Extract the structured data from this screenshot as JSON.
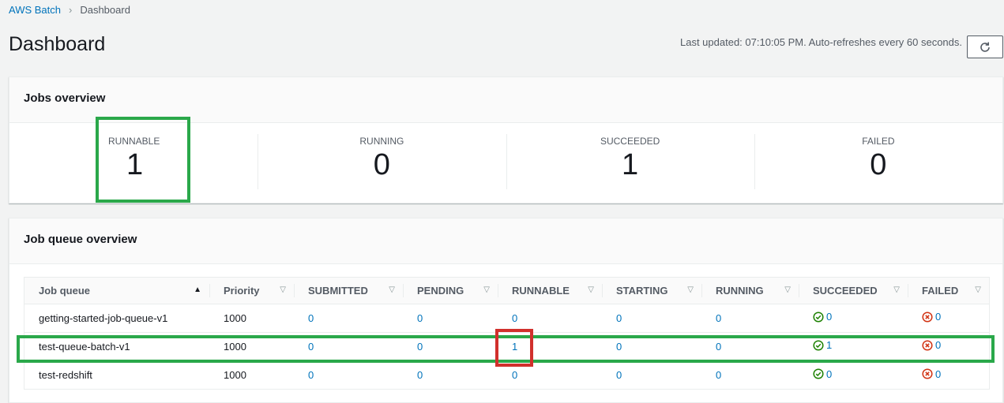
{
  "breadcrumb": {
    "root": "AWS Batch",
    "current": "Dashboard"
  },
  "page": {
    "title": "Dashboard",
    "last_updated": "Last updated: 07:10:05 PM. Auto-refreshes every 60 seconds."
  },
  "jobs_overview": {
    "title": "Jobs overview",
    "stats": [
      {
        "label": "RUNNABLE",
        "value": "1"
      },
      {
        "label": "RUNNING",
        "value": "0"
      },
      {
        "label": "SUCCEEDED",
        "value": "1"
      },
      {
        "label": "FAILED",
        "value": "0"
      }
    ]
  },
  "job_queue_overview": {
    "title": "Job queue overview",
    "columns": [
      "Job queue",
      "Priority",
      "SUBMITTED",
      "PENDING",
      "RUNNABLE",
      "STARTING",
      "RUNNING",
      "SUCCEEDED",
      "FAILED"
    ],
    "rows": [
      {
        "name": "getting-started-job-queue-v1",
        "priority": "1000",
        "submitted": "0",
        "pending": "0",
        "runnable": "0",
        "starting": "0",
        "running": "0",
        "succeeded": "0",
        "failed": "0"
      },
      {
        "name": "test-queue-batch-v1",
        "priority": "1000",
        "submitted": "0",
        "pending": "0",
        "runnable": "1",
        "starting": "0",
        "running": "0",
        "succeeded": "1",
        "failed": "0"
      },
      {
        "name": "test-redshift",
        "priority": "1000",
        "submitted": "0",
        "pending": "0",
        "runnable": "0",
        "starting": "0",
        "running": "0",
        "succeeded": "0",
        "failed": "0"
      }
    ]
  },
  "colors": {
    "link": "#0073bb",
    "success": "#1d8102",
    "error": "#d13212",
    "highlight_green": "#2aa84a",
    "highlight_red": "#d1302c"
  }
}
